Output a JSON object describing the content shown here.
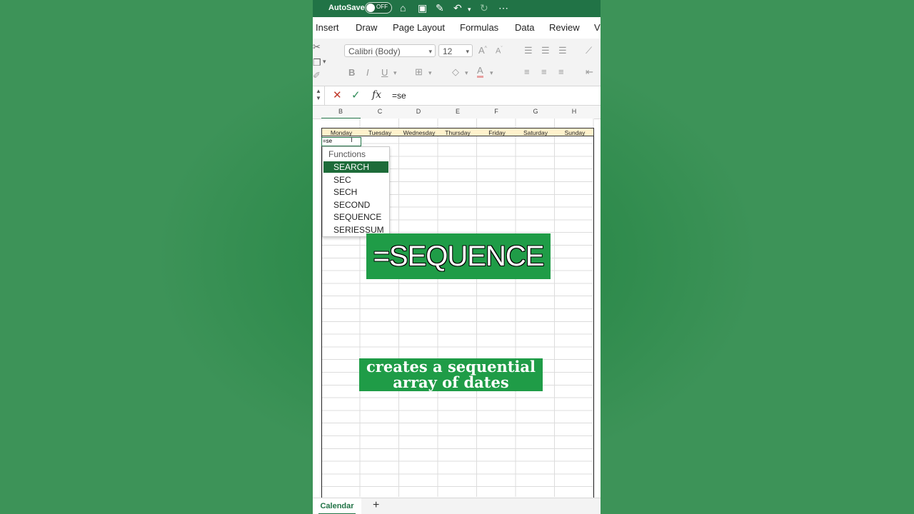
{
  "titlebar": {
    "autosave_label": "AutoSave",
    "toggle_state": "OFF",
    "icons": [
      "home-icon",
      "save-icon",
      "edit-icon",
      "undo-icon",
      "chevron-down-icon",
      "redo-icon",
      "more-icon"
    ]
  },
  "tabs": [
    "Insert",
    "Draw",
    "Page Layout",
    "Formulas",
    "Data",
    "Review",
    "V"
  ],
  "ribbon": {
    "font_name": "Calibri (Body)",
    "font_size": "12"
  },
  "formula_bar": {
    "value": "=se"
  },
  "columns": [
    "B",
    "C",
    "D",
    "E",
    "F",
    "G",
    "H"
  ],
  "days": [
    "Monday",
    "Tuesday",
    "Wednesday",
    "Thursday",
    "Friday",
    "Saturday",
    "Sunday"
  ],
  "active_cell_text": "=se",
  "autocomplete": {
    "header": "Functions",
    "items": [
      "SEARCH",
      "SEC",
      "SECH",
      "SECOND",
      "SEQUENCE",
      "SERIESSUM"
    ],
    "selected": "SEARCH"
  },
  "overlay": {
    "title": "=SEQUENCE",
    "caption_line1": "creates a sequential",
    "caption_line2": "array of dates"
  },
  "sheet": {
    "tab_name": "Calendar",
    "add_label": "+"
  },
  "colors": {
    "excel_green": "#217346",
    "overlay_green": "#1f9c47",
    "header_fill": "#fff2cc"
  }
}
